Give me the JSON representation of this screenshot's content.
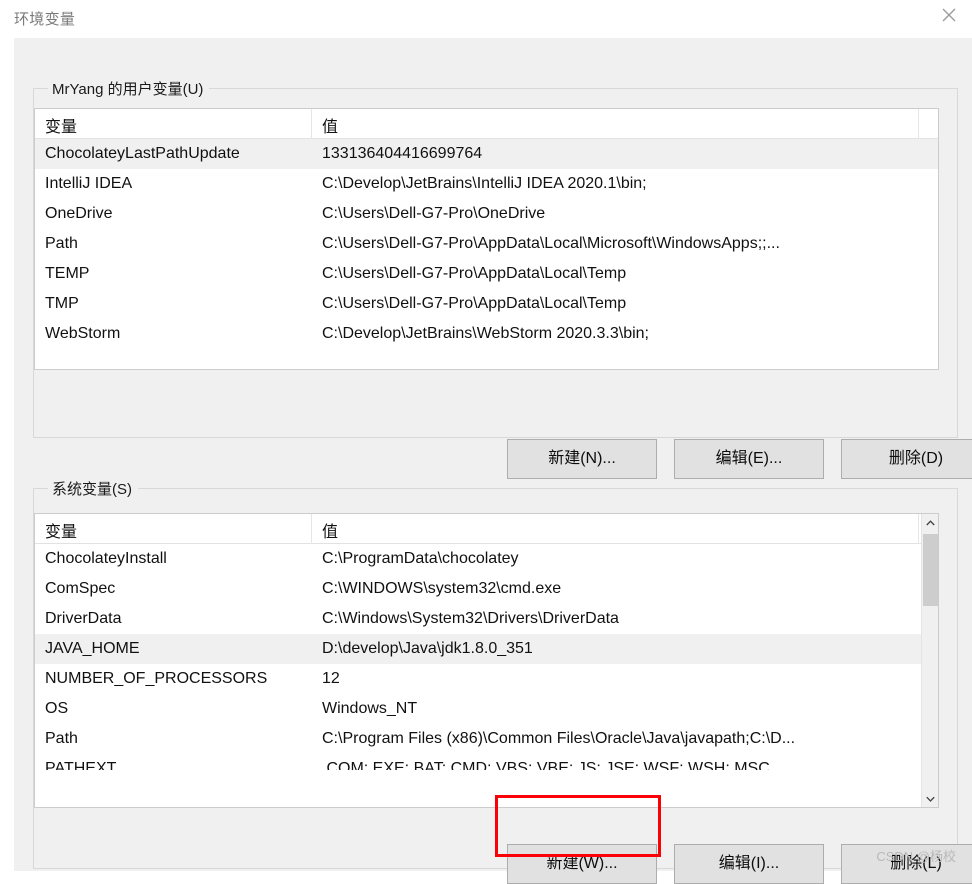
{
  "window": {
    "title": "环境变量",
    "close_icon": "close-icon"
  },
  "user_section": {
    "group_label": "MrYang 的用户变量(U)",
    "columns": [
      "变量",
      "值"
    ],
    "rows": [
      {
        "name": "ChocolateyLastPathUpdate",
        "value": "133136404416699764",
        "selected": true
      },
      {
        "name": "IntelliJ IDEA",
        "value": "C:\\Develop\\JetBrains\\IntelliJ IDEA 2020.1\\bin;",
        "selected": false
      },
      {
        "name": "OneDrive",
        "value": "C:\\Users\\Dell-G7-Pro\\OneDrive",
        "selected": false
      },
      {
        "name": "Path",
        "value": "C:\\Users\\Dell-G7-Pro\\AppData\\Local\\Microsoft\\WindowsApps;;...",
        "selected": false
      },
      {
        "name": "TEMP",
        "value": "C:\\Users\\Dell-G7-Pro\\AppData\\Local\\Temp",
        "selected": false
      },
      {
        "name": "TMP",
        "value": "C:\\Users\\Dell-G7-Pro\\AppData\\Local\\Temp",
        "selected": false
      },
      {
        "name": "WebStorm",
        "value": "C:\\Develop\\JetBrains\\WebStorm 2020.3.3\\bin;",
        "selected": false
      }
    ],
    "buttons": {
      "new": "新建(N)...",
      "edit": "编辑(E)...",
      "delete": "删除(D)"
    }
  },
  "system_section": {
    "group_label": "系统变量(S)",
    "columns": [
      "变量",
      "值"
    ],
    "rows": [
      {
        "name": "ChocolateyInstall",
        "value": "C:\\ProgramData\\chocolatey",
        "selected": false
      },
      {
        "name": "ComSpec",
        "value": "C:\\WINDOWS\\system32\\cmd.exe",
        "selected": false
      },
      {
        "name": "DriverData",
        "value": "C:\\Windows\\System32\\Drivers\\DriverData",
        "selected": false
      },
      {
        "name": "JAVA_HOME",
        "value": "D:\\develop\\Java\\jdk1.8.0_351",
        "selected": true
      },
      {
        "name": "NUMBER_OF_PROCESSORS",
        "value": "12",
        "selected": false
      },
      {
        "name": "OS",
        "value": "Windows_NT",
        "selected": false
      },
      {
        "name": "Path",
        "value": "C:\\Program Files (x86)\\Common Files\\Oracle\\Java\\javapath;C:\\D...",
        "selected": false
      },
      {
        "name": "PATHEXT",
        "value": ".COM;.EXE;.BAT;.CMD;.VBS;.VBE;.JS;.JSE;.WSF;.WSH;.MSC",
        "selected": false,
        "clipped": true
      }
    ],
    "buttons": {
      "new": "新建(W)...",
      "edit": "编辑(I)...",
      "delete": "删除(L)"
    },
    "scrollbar": {
      "up_arrow": "chevron-up-icon",
      "down_arrow": "chevron-down-icon"
    }
  },
  "annotation": {
    "highlight_color": "#fb0007",
    "highlight_target": "新建(W)..."
  },
  "watermark": {
    "text": "CSDN @杨校"
  }
}
